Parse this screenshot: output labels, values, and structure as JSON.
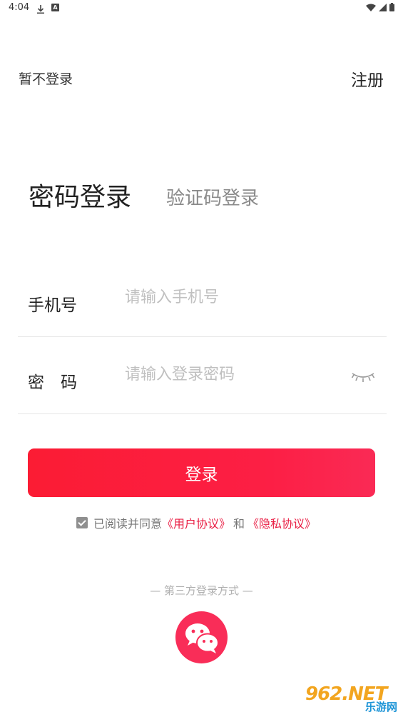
{
  "status_bar": {
    "time": "4:04",
    "app_badge": "A"
  },
  "header": {
    "skip_login": "暂不登录",
    "register": "注册"
  },
  "tabs": {
    "password_login": "密码登录",
    "code_login": "验证码登录"
  },
  "form": {
    "phone_label": "手机号",
    "phone_placeholder": "请输入手机号",
    "password_label": "密　码",
    "password_placeholder": "请输入登录密码"
  },
  "login_button": "登录",
  "agreement": {
    "checked": true,
    "prefix": "已阅读并同意",
    "user_agreement": "《用户协议》",
    "and": "和",
    "privacy_policy": "《隐私协议》"
  },
  "third_party": {
    "label": "— 第三方登录方式 —",
    "icon": "wechat-icon"
  },
  "watermark": {
    "top": "962.NET",
    "bottom": "乐游网"
  },
  "colors": {
    "accent": "#fc1f45",
    "link": "#e91d43",
    "wechat_bg": "#f92d58"
  }
}
